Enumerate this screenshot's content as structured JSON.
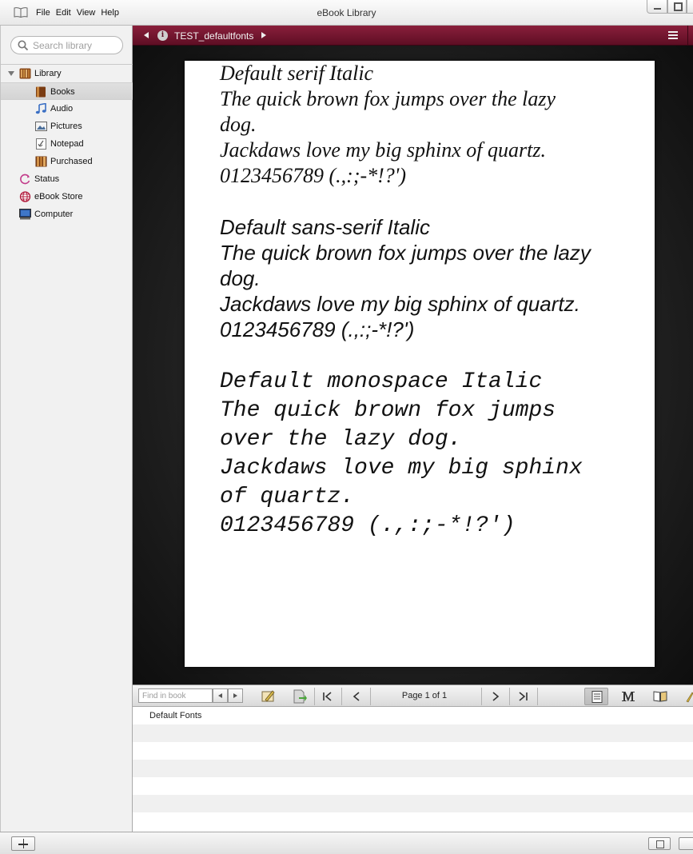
{
  "window": {
    "title": "eBook Library",
    "menu": [
      "File",
      "Edit",
      "View",
      "Help"
    ]
  },
  "sidebar": {
    "search_placeholder": "Search library",
    "items": [
      {
        "label": "Library",
        "icon": "library-icon",
        "level": 0,
        "expanded": true
      },
      {
        "label": "Books",
        "icon": "books-icon",
        "level": 1,
        "selected": true
      },
      {
        "label": "Audio",
        "icon": "audio-icon",
        "level": 1
      },
      {
        "label": "Pictures",
        "icon": "pictures-icon",
        "level": 1
      },
      {
        "label": "Notepad",
        "icon": "notepad-icon",
        "level": 1
      },
      {
        "label": "Purchased",
        "icon": "purchased-icon",
        "level": 1
      },
      {
        "label": "Status",
        "icon": "status-icon",
        "level": 0
      },
      {
        "label": "eBook Store",
        "icon": "globe-icon",
        "level": 0
      },
      {
        "label": "Computer",
        "icon": "computer-icon",
        "level": 0
      }
    ]
  },
  "reader": {
    "book_title": "TEST_defaultfonts",
    "info_glyph": "i",
    "accent_color": "#6e1530",
    "page": {
      "serif_block": [
        "Default serif Italic",
        "The quick brown fox jumps over the lazy",
        "dog.",
        "Jackdaws love my big sphinx of quartz.",
        "0123456789 (.,:;-*!?')"
      ],
      "sans_block": [
        "Default sans-serif Italic",
        "The quick brown fox jumps over the lazy",
        "dog.",
        "Jackdaws love my big sphinx of quartz.",
        "0123456789 (.,:;-*!?')"
      ],
      "mono_block": [
        "Default monospace Italic",
        "The quick brown fox jumps",
        "over the lazy dog.",
        "Jackdaws love my big sphinx",
        "of quartz.",
        "0123456789 (.,:;-*!?')"
      ]
    }
  },
  "controls": {
    "find_placeholder": "Find in book",
    "page_indicator": "Page 1 of 1"
  },
  "toc": {
    "rows": [
      "Default Fonts",
      "",
      "",
      "",
      "",
      "",
      ""
    ]
  }
}
